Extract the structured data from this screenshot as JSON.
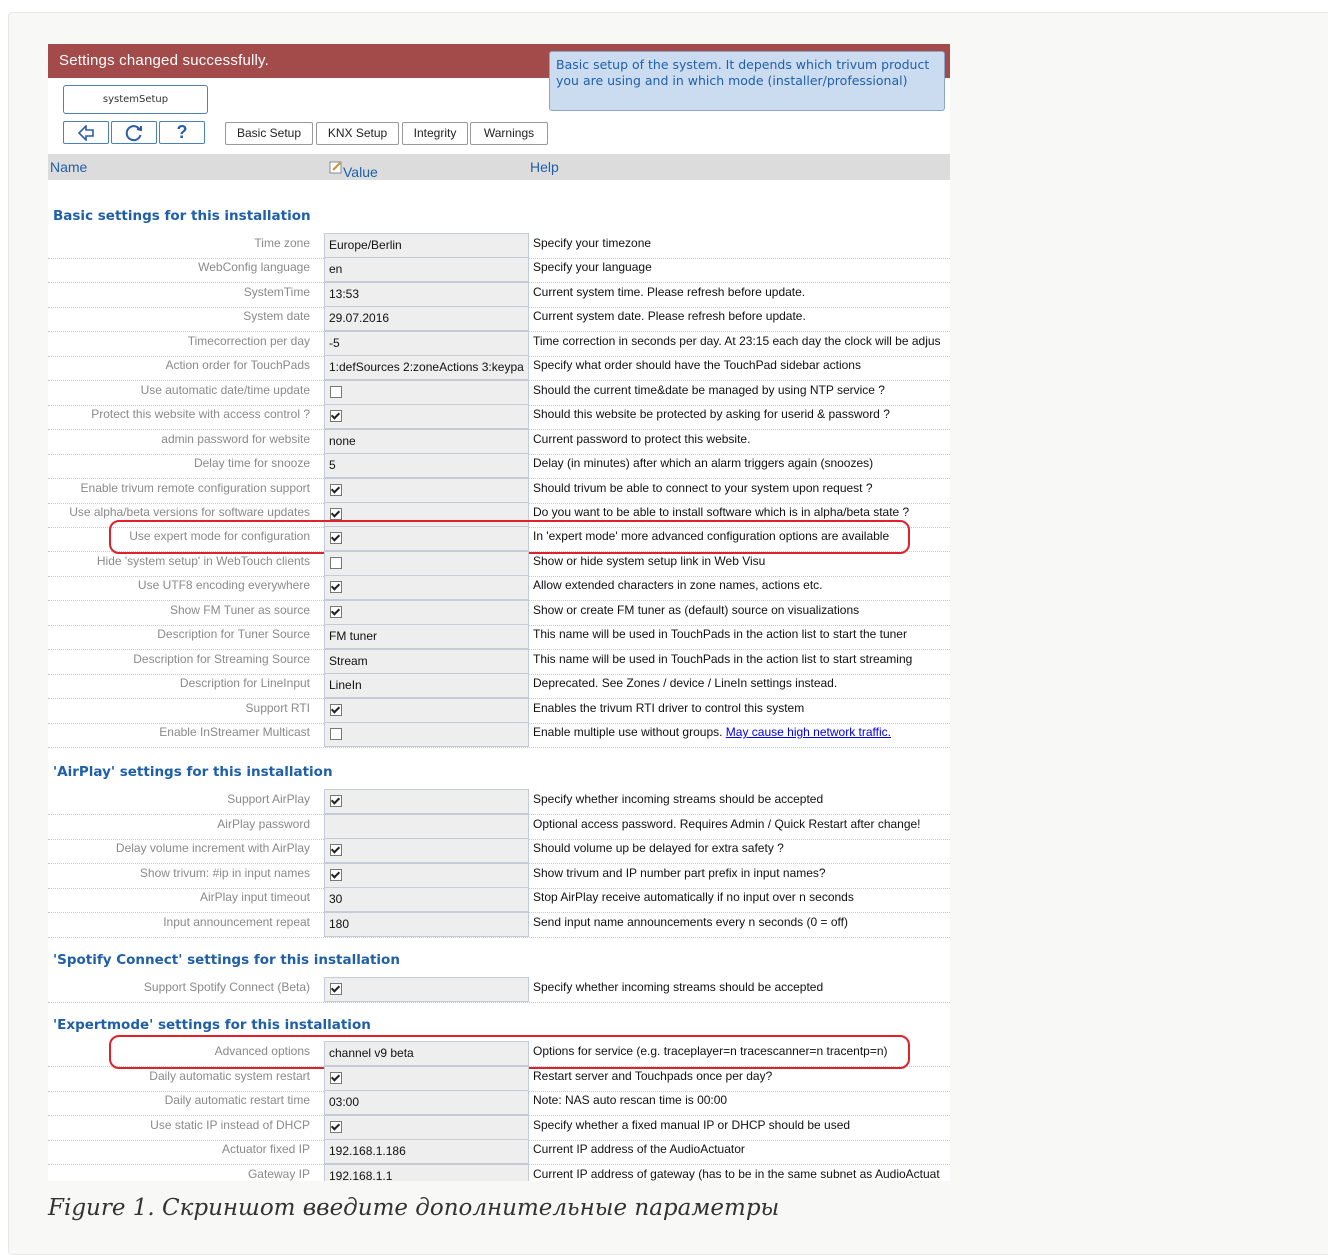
{
  "banner": "Settings changed successfully.",
  "infobox": "Basic setup of the system. It depends which trivum product you are using and in which mode (installer/professional)",
  "setup_button": "systemSetup",
  "toolbar": {
    "icons": [
      "back-icon",
      "refresh-icon",
      "help-icon"
    ],
    "help_glyph": "?",
    "tabs": [
      "Basic Setup",
      "KNX Setup",
      "Integrity",
      "Warnings"
    ]
  },
  "columns": {
    "name": "Name",
    "value": "Value",
    "help": "Help"
  },
  "sections": [
    {
      "title": "Basic settings for this installation",
      "rows": [
        {
          "name": "Time zone",
          "value": "Europe/Berlin",
          "help": "Specify your timezone"
        },
        {
          "name": "WebConfig language",
          "value": "en",
          "help": "Specify your language"
        },
        {
          "name": "SystemTime",
          "value": "13:53",
          "help": "Current system time. Please refresh before update."
        },
        {
          "name": "System date",
          "value": "29.07.2016",
          "help": "Current system date. Please refresh before update."
        },
        {
          "name": "Timecorrection per day",
          "value": "-5",
          "help": "Time correction in seconds per day. At 23:15 each day the clock will be adjus"
        },
        {
          "name": "Action order for TouchPads",
          "value": "1:defSources 2:zoneActions 3:keypa",
          "help": "Specify what order should have the TouchPad sidebar actions"
        },
        {
          "name": "Use automatic date/time update",
          "checkbox": false,
          "help": "Should the current time&date be managed by using NTP service ?"
        },
        {
          "name": "Protect this website with access control ?",
          "checkbox": true,
          "help": "Should this website be protected by asking for userid & password ?"
        },
        {
          "name": "admin password for website",
          "value": "none",
          "help": "Current password to protect this website."
        },
        {
          "name": "Delay time for snooze",
          "value": "5",
          "help": "Delay (in minutes) after which an alarm triggers again (snoozes)"
        },
        {
          "name": "Enable trivum remote configuration support",
          "checkbox": true,
          "help": "Should trivum be able to connect to your system upon request ?"
        },
        {
          "name": "Use alpha/beta versions for software updates",
          "checkbox": true,
          "help": "Do you want to be able to install software which is in alpha/beta state ?"
        },
        {
          "name": "Use expert mode for configuration",
          "checkbox": true,
          "help": "In 'expert mode' more advanced configuration options are available",
          "highlight": true
        },
        {
          "name": "Hide 'system setup' in WebTouch clients",
          "checkbox": false,
          "help": "Show or hide system setup link in Web Visu"
        },
        {
          "name": "Use UTF8 encoding everywhere",
          "checkbox": true,
          "help": "Allow extended characters in zone names, actions etc."
        },
        {
          "name": "Show FM Tuner as source",
          "checkbox": true,
          "help": "Show or create FM tuner as (default) source on visualizations"
        },
        {
          "name": "Description for Tuner Source",
          "value": "FM tuner",
          "help": "This name will be used in TouchPads in the action list to start the tuner"
        },
        {
          "name": "Description for Streaming Source",
          "value": "Stream",
          "help": "This name will be used in TouchPads in the action list to start streaming"
        },
        {
          "name": "Description for LineInput",
          "value": "LineIn",
          "help": "Deprecated. See Zones / device / LineIn settings instead."
        },
        {
          "name": "Support RTI",
          "checkbox": true,
          "help": "Enables the trivum RTI driver to control this system"
        },
        {
          "name": "Enable InStreamer Multicast",
          "checkbox": false,
          "help": "Enable multiple use without groups.",
          "link": "May cause high network traffic."
        }
      ]
    },
    {
      "title": "'AirPlay' settings for this installation",
      "rows": [
        {
          "name": "Support AirPlay",
          "checkbox": true,
          "help": "Specify whether incoming streams should be accepted"
        },
        {
          "name": "AirPlay password",
          "value": "",
          "help": "Optional access password. Requires Admin / Quick Restart after change!"
        },
        {
          "name": "Delay volume increment with AirPlay",
          "checkbox": true,
          "help": "Should volume up be delayed for extra safety ?"
        },
        {
          "name": "Show trivum: #ip in input names",
          "checkbox": true,
          "help": "Show trivum and IP number part prefix in input names?"
        },
        {
          "name": "AirPlay input timeout",
          "value": "30",
          "help": "Stop AirPlay receive automatically if no input over n seconds"
        },
        {
          "name": "Input announcement repeat",
          "value": "180",
          "help": "Send input name announcements every n seconds (0 = off)"
        }
      ]
    },
    {
      "title": "'Spotify Connect' settings for this installation",
      "rows": [
        {
          "name": "Support Spotify Connect (Beta)",
          "checkbox": true,
          "help": "Specify whether incoming streams should be accepted"
        }
      ]
    },
    {
      "title": "'Expertmode' settings for this installation",
      "rows": [
        {
          "name": "Advanced options",
          "value": "channel v9 beta",
          "help": "Options for service (e.g. traceplayer=n tracescanner=n tracentp=n)",
          "highlight": true
        },
        {
          "name": "Daily automatic system restart",
          "checkbox": true,
          "help": "Restart server and Touchpads once per day?"
        },
        {
          "name": "Daily automatic restart time",
          "value": "03:00",
          "help": "Note: NAS auto rescan time is 00:00"
        },
        {
          "name": "Use static IP instead of DHCP",
          "checkbox": true,
          "help": "Specify whether a fixed manual IP or DHCP should be used"
        },
        {
          "name": "Actuator fixed IP",
          "value": "192.168.1.186",
          "help": "Current IP address of the AudioActuator"
        },
        {
          "name": "Gateway IP",
          "value": "192.168.1.1",
          "help": "Current IP address of gateway (has to be in the same subnet as AudioActuat"
        }
      ]
    }
  ],
  "caption": "Figure 1. Скриншот введите дополнительные параметры"
}
